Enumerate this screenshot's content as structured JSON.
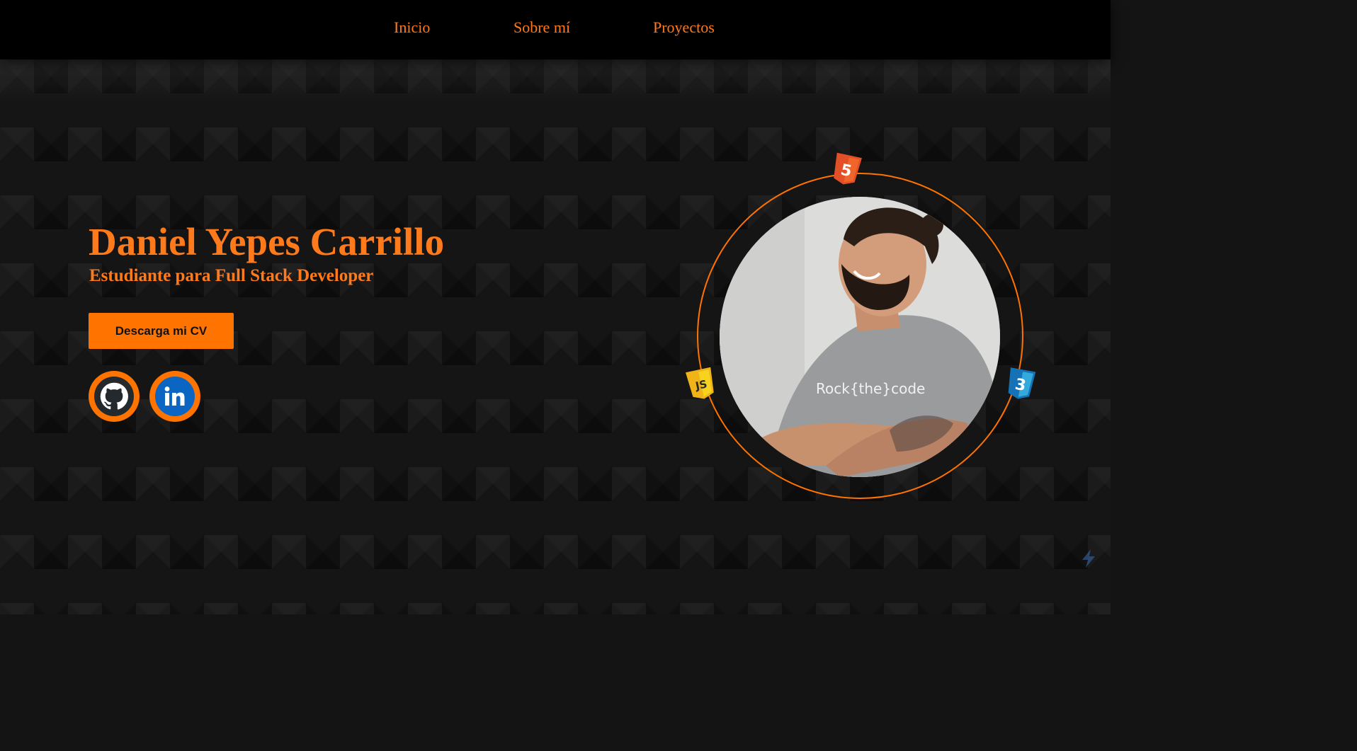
{
  "nav": {
    "items": [
      {
        "label": "Inicio"
      },
      {
        "label": "Sobre mí"
      },
      {
        "label": "Proyectos"
      }
    ]
  },
  "hero": {
    "name": "Daniel Yepes Carrillo",
    "subtitle": "Estudiante para Full Stack Developer",
    "cv_button_label": "Descarga mi CV",
    "social": [
      {
        "icon": "github-icon"
      },
      {
        "icon": "linkedin-icon"
      }
    ],
    "photo_shirt_text": "Rock{the}code",
    "tech_badges": [
      {
        "icon": "html5-icon",
        "label": "5"
      },
      {
        "icon": "javascript-icon",
        "label": "JS"
      },
      {
        "icon": "css3-icon",
        "label": "3"
      }
    ]
  },
  "colors": {
    "accent": "#ff7300",
    "nav_background": "#000000",
    "page_background": "#151515"
  }
}
